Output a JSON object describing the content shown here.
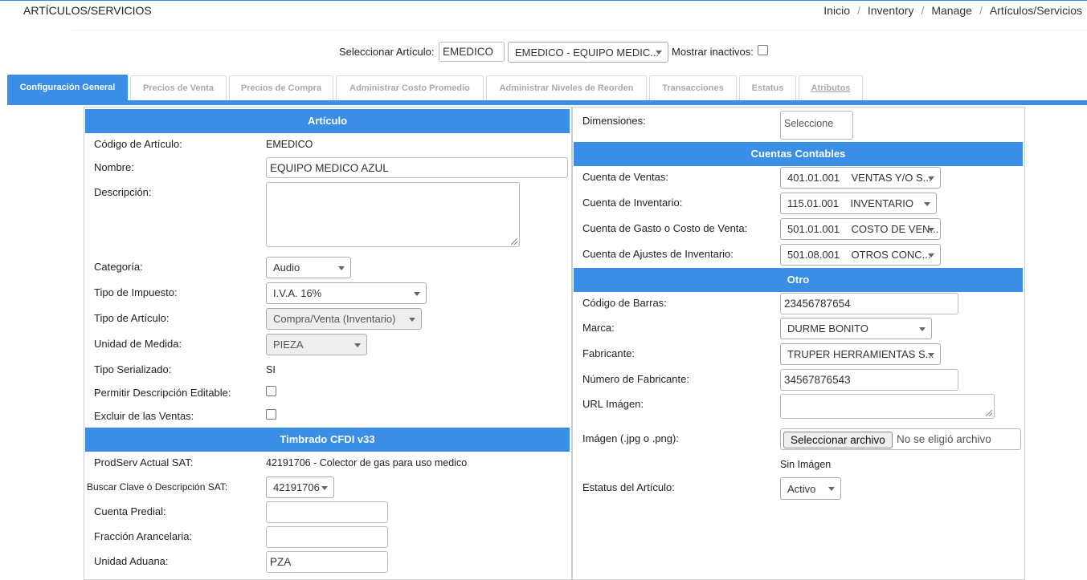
{
  "header": {
    "title": "ARTÍCULOS/SERVICIOS",
    "breadcrumb": [
      "Inicio",
      "Inventory",
      "Manage",
      "Artículos/Servicios"
    ]
  },
  "selector": {
    "label": "Seleccionar Artículo:",
    "code_value": "EMEDICO",
    "article_select": "EMEDICO - EQUIPO MEDIC...",
    "inactive_label": "Mostrar inactivos:",
    "inactive_checked": false
  },
  "tabs": [
    "Configuración General",
    "Precios de Venta",
    "Precios de Compra",
    "Administrar Costo Promedio",
    "Administrar Niveles de Reorden",
    "Transacciones",
    "Estatus",
    "Atributos"
  ],
  "articulo": {
    "heading": "Artículo",
    "codigo_label": "Código de Artículo:",
    "codigo_value": "EMEDICO",
    "nombre_label": "Nombre:",
    "nombre_value": "EQUIPO MEDICO AZUL",
    "descripcion_label": "Descripción:",
    "descripcion_value": "",
    "categoria_label": "Categoría:",
    "categoria_value": "Audio",
    "impuesto_label": "Tipo de Impuesto:",
    "impuesto_value": "I.V.A. 16%",
    "tipo_label": "Tipo de Artículo:",
    "tipo_value": "Compra/Venta (Inventario)",
    "unidad_label": "Unidad de Medida:",
    "unidad_value": "PIEZA",
    "serializado_label": "Tipo Serializado:",
    "serializado_value": "SI",
    "editable_label": "Permitir Descripción Editable:",
    "excluir_label": "Excluir de las Ventas:"
  },
  "timbrado": {
    "heading": "Timbrado CFDI v33",
    "prodserv_label": "ProdServ Actual SAT:",
    "prodserv_value": "42191706 - Colector de gas para uso medico",
    "buscar_label": "Buscar Clave ó Descripción SAT:",
    "buscar_value": "42191706",
    "predial_label": "Cuenta Predial:",
    "predial_value": "",
    "fraccion_label": "Fracción Arancelaria:",
    "fraccion_value": "",
    "aduana_label": "Unidad Aduana:",
    "aduana_value": "PZA"
  },
  "right": {
    "dimensiones_label": "Dimensiones:",
    "dimensiones_value": "Seleccione",
    "cuentas_heading": "Cuentas Contables",
    "ventas_label": "Cuenta de Ventas:",
    "ventas_value": "401.01.001    VENTAS Y/O S...",
    "inventario_label": "Cuenta de Inventario:",
    "inventario_value": "115.01.001    INVENTARIO",
    "gasto_label": "Cuenta de Gasto o Costo de Venta:",
    "gasto_value": "501.01.001    COSTO DE VEN...",
    "ajustes_label": "Cuenta de Ajustes de Inventario:",
    "ajustes_value": "501.08.001    OTROS CONC...",
    "otro_heading": "Otro",
    "barras_label": "Código de Barras:",
    "barras_value": "23456787654",
    "marca_label": "Marca:",
    "marca_value": "DURME BONITO",
    "fabricante_label": "Fabricante:",
    "fabricante_value": "TRUPER HERRAMIENTAS S...",
    "numfab_label": "Número de Fabricante:",
    "numfab_value": "34567876543",
    "url_label": "URL Imágen:",
    "url_value": "",
    "imagen_label": "Imágen (.jpg o .png):",
    "file_button": "Seleccionar archivo",
    "file_text": "No se eligió archivo",
    "sin_imagen": "Sin Imágen",
    "estatus_label": "Estatus del Artículo:",
    "estatus_value": "Activo"
  }
}
